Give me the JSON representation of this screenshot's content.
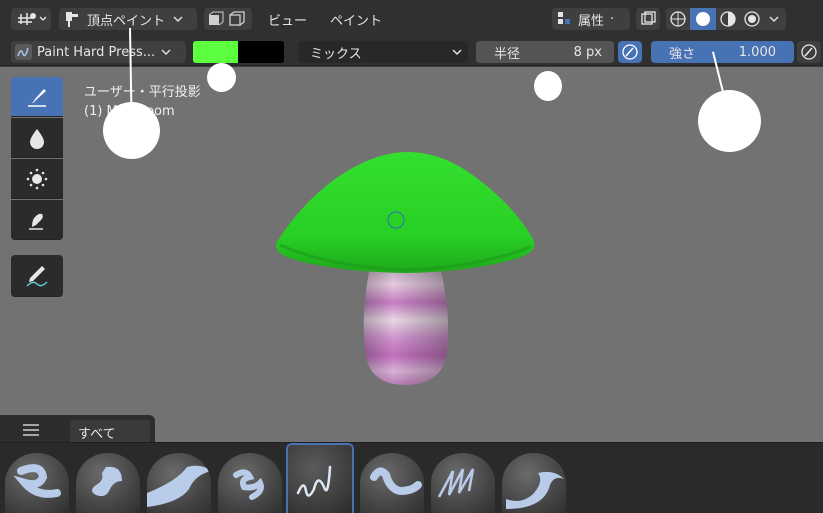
{
  "header": {
    "mode_label": "頂点ペイント",
    "menus": [
      "ビュー",
      "ペイント"
    ],
    "attribute_label": "属性",
    "shading_modes": [
      "wireframe-icon",
      "solid-icon",
      "material-icon",
      "rendered-icon"
    ]
  },
  "toolsettings": {
    "brush_name": "Paint Hard Press...",
    "primary_color": "#5cff3d",
    "secondary_color": "#000000",
    "blend_mode": "ミックス",
    "radius_label": "半径",
    "radius_value": "8 px",
    "strength_label": "強さ",
    "strength_value": "1.000"
  },
  "viewport": {
    "view_line": "ユーザー・平行投影",
    "object_line": "(1) Mushroom"
  },
  "tools": [
    "brush-icon",
    "blur-icon",
    "average-icon",
    "smear-icon",
    "annotate-icon"
  ],
  "asset_shelf": {
    "tab_label": "すべて"
  },
  "colors": {
    "accent": "#4772b3",
    "cap_green": "#2fd92a",
    "stem_pink": "#c77ec4"
  }
}
